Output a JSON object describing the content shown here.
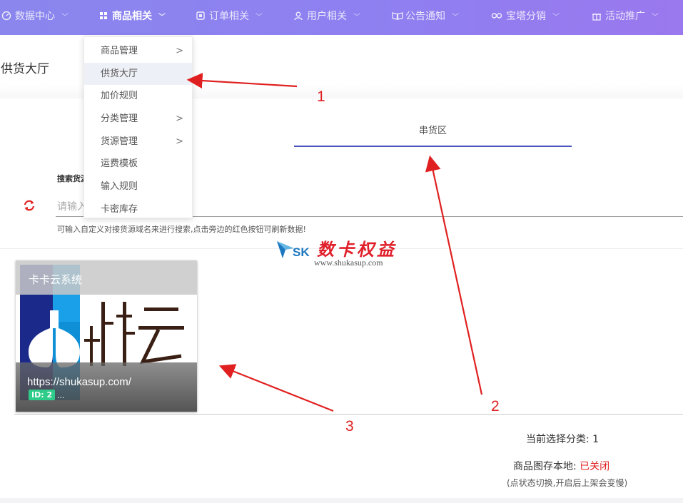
{
  "nav": {
    "items": [
      {
        "label": "数据中心",
        "icon": "dashboard-icon",
        "active": false
      },
      {
        "label": "商品相关",
        "icon": "grid-icon",
        "active": true
      },
      {
        "label": "订单相关",
        "icon": "order-icon",
        "active": false
      },
      {
        "label": "用户相关",
        "icon": "user-icon",
        "active": false
      },
      {
        "label": "公告通知",
        "icon": "book-icon",
        "active": false
      },
      {
        "label": "宝塔分销",
        "icon": "link-icon",
        "active": false
      },
      {
        "label": "活动推广",
        "icon": "gift-icon",
        "active": false
      }
    ]
  },
  "dropdown": {
    "items": [
      {
        "label": "商品管理",
        "has_submenu": true,
        "selected": false
      },
      {
        "label": "供货大厅",
        "has_submenu": false,
        "selected": true
      },
      {
        "label": "加价规则",
        "has_submenu": false,
        "selected": false
      },
      {
        "label": "分类管理",
        "has_submenu": true,
        "selected": false
      },
      {
        "label": "货源管理",
        "has_submenu": true,
        "selected": false
      },
      {
        "label": "运费模板",
        "has_submenu": false,
        "selected": false
      },
      {
        "label": "输入规则",
        "has_submenu": false,
        "selected": false
      },
      {
        "label": "卡密库存",
        "has_submenu": false,
        "selected": false
      }
    ],
    "submenu_arrow": ">"
  },
  "page": {
    "title": "供货大厅"
  },
  "tabs": {
    "active_label": "串货区"
  },
  "search": {
    "label": "搜索货源",
    "placeholder": "请输入",
    "hint": "可输入自定义对接货源域名来进行搜索,点击旁边的红色按钮可刷新数据!"
  },
  "watermark": {
    "brand": "SK",
    "name": "数卡权益",
    "url": "www.shukasup.com"
  },
  "card": {
    "name": "卡卡云系统",
    "logo_text": "卡卡云",
    "url": "https://shukasup.com/",
    "badge": "ID: 2",
    "ellipsis": "..."
  },
  "status": {
    "category_label": "当前选择分类: ",
    "category_value": "1",
    "image_label": "商品图存本地: ",
    "image_value": "已关闭",
    "note": "(点状态切换,开启后上架会变慢)"
  },
  "annotations": {
    "labels": [
      "1",
      "2",
      "3"
    ]
  },
  "colors": {
    "nav_gradient_start": "#8a86ee",
    "nav_gradient_end": "#9a78ee",
    "tab_underline": "#4b53bc",
    "annotation_red": "#e02020",
    "badge_green": "#2ecc8a",
    "status_red": "#e02020"
  }
}
